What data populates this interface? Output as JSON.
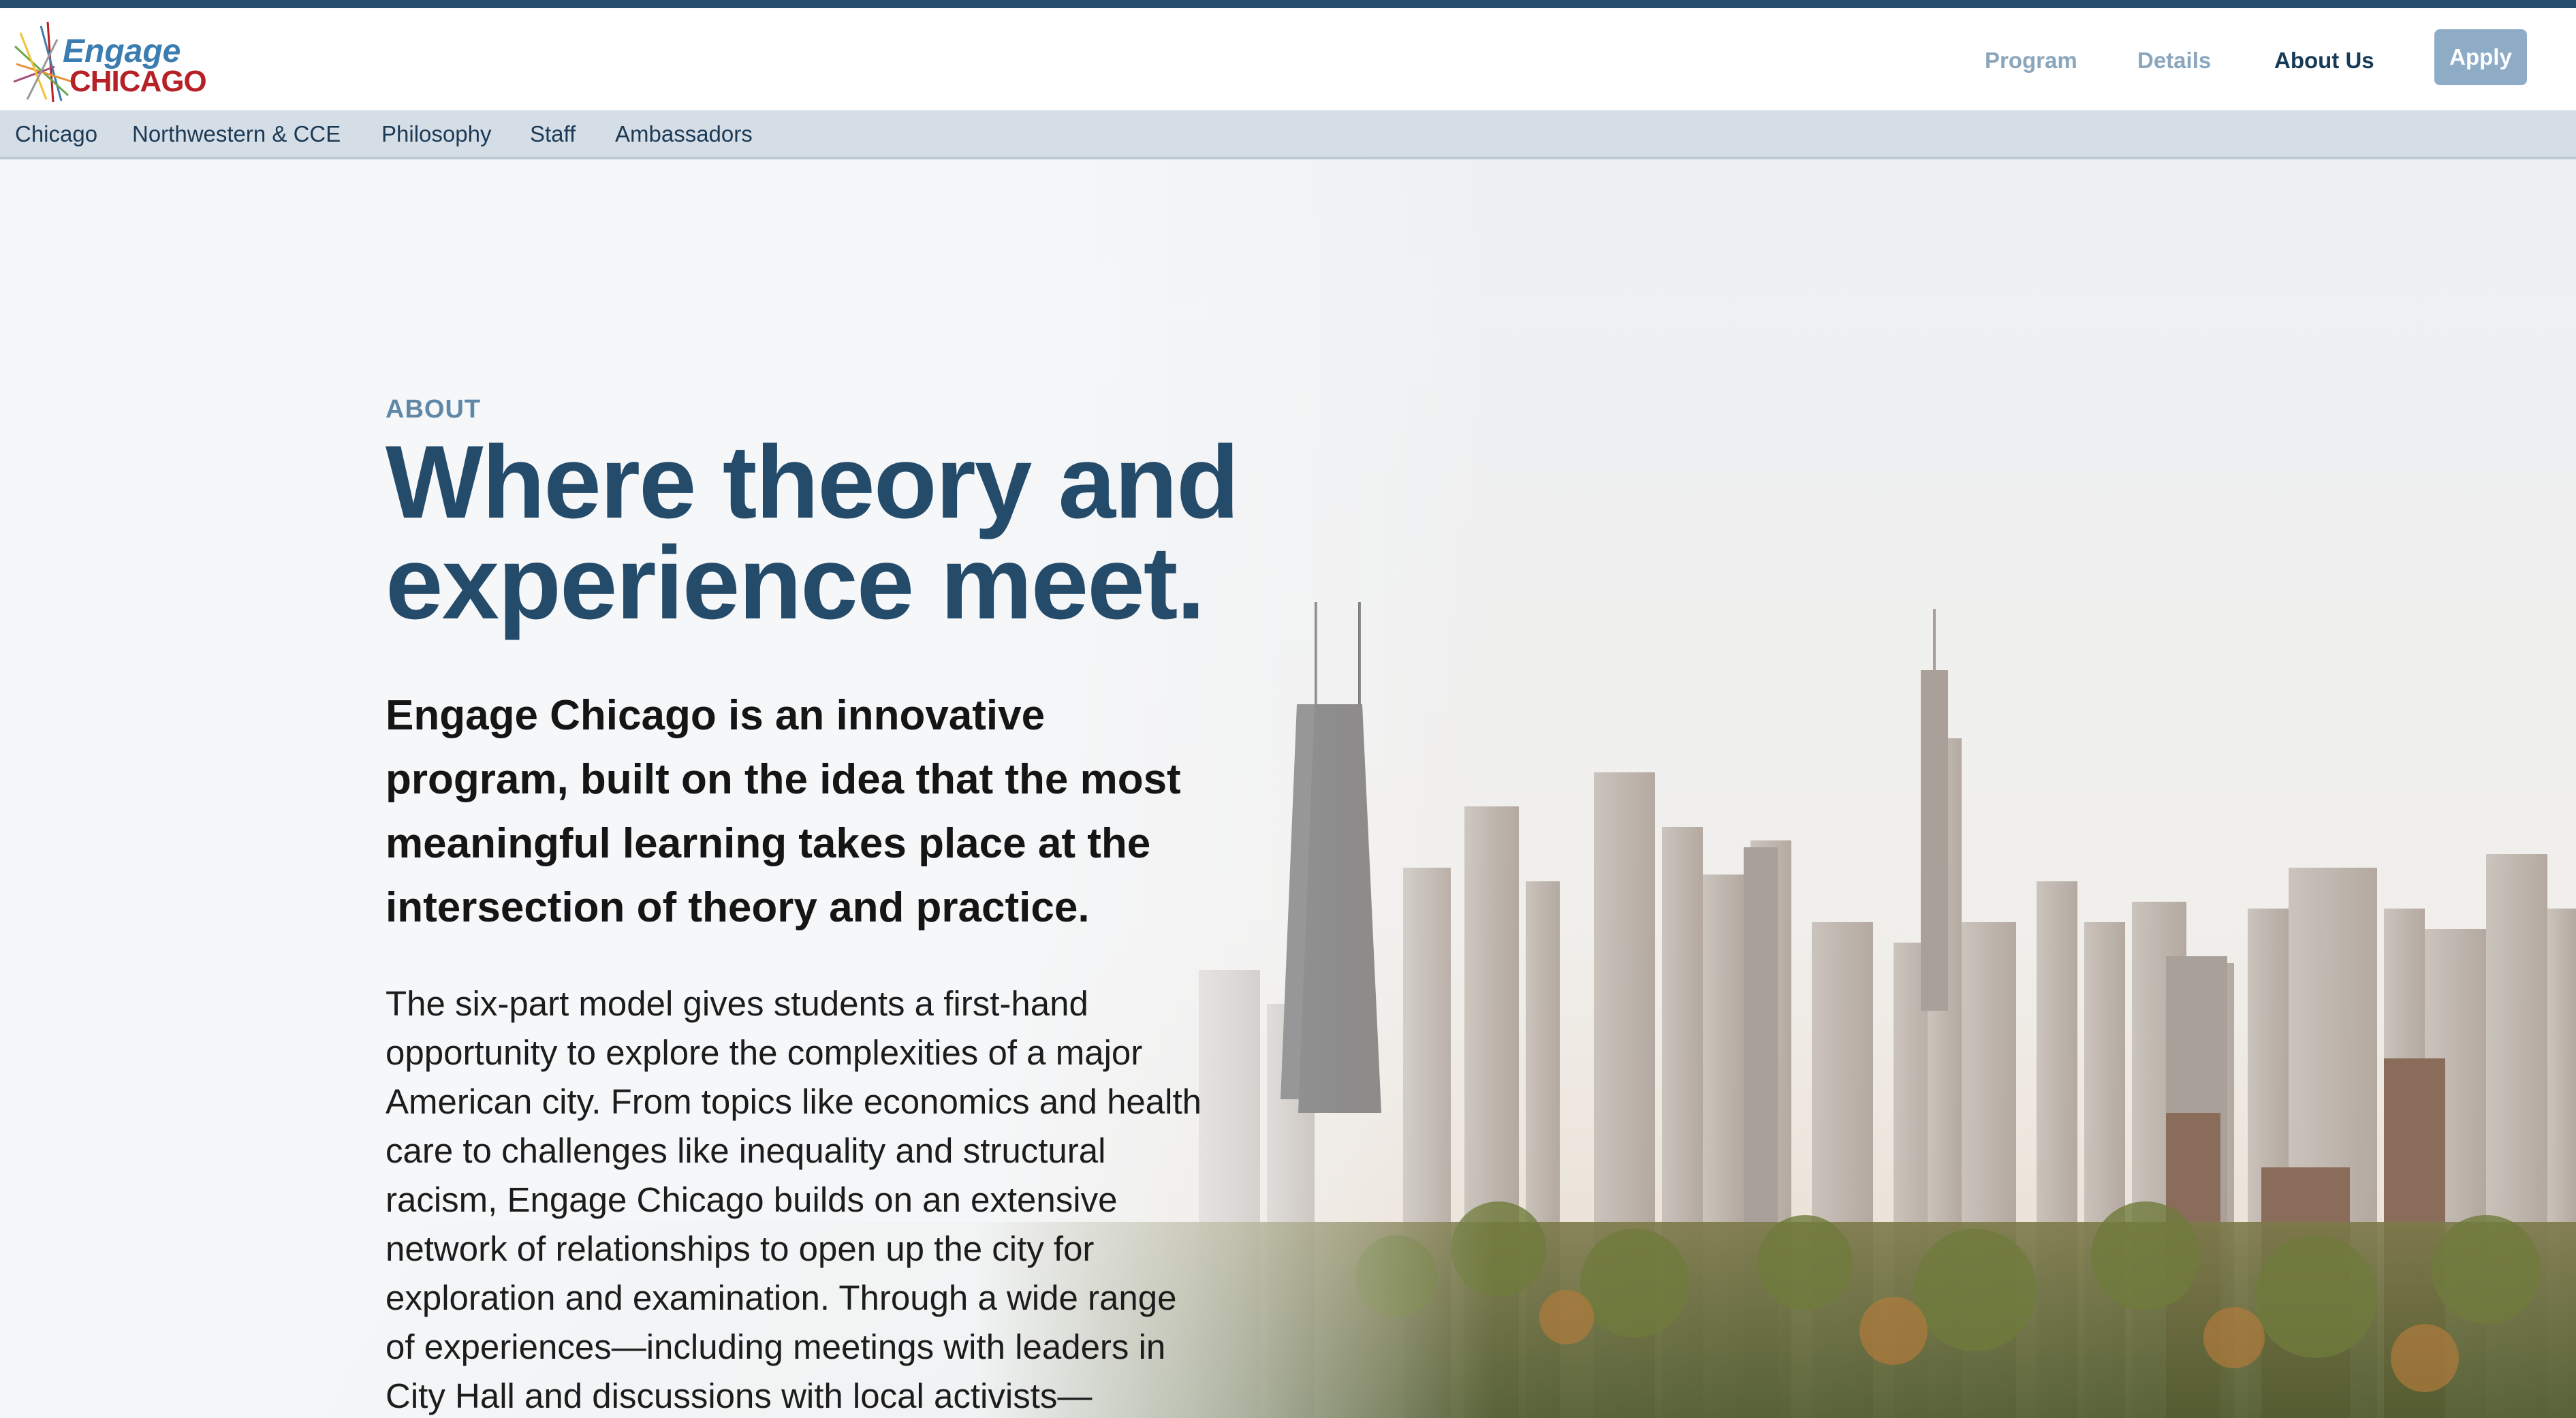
{
  "logo": {
    "line1": "Engage",
    "line2": "CHICAGO"
  },
  "nav": {
    "program": "Program",
    "details": "Details",
    "about": "About Us",
    "apply": "Apply"
  },
  "subnav": [
    "Chicago",
    "Northwestern & CCE",
    "Philosophy",
    "Staff",
    "Ambassadors"
  ],
  "hero": {
    "eyebrow": "ABOUT",
    "headline_line1": "Where theory and",
    "headline_line2": "experience meet.",
    "lead": "Engage Chicago is an innovative program, built on the idea that the most meaningful learning takes place at the intersection of theory and practice.",
    "body": "The six-part model gives students a first-hand opportunity to explore the complexities of a major American city. From topics like economics and health care to challenges like inequality and structural racism, Engage Chicago builds on an extensive network of relationships to open up the city for exploration and examination. Through a wide range of experiences—including meetings with leaders in City Hall and discussions with local activists—students"
  },
  "colors": {
    "topbar": "#264d6b",
    "headline": "#254b6b",
    "eyebrow": "#5f88a8",
    "nav_muted": "#8aa6bd",
    "nav_active": "#173a57",
    "apply_bg": "#8eacc6",
    "subnav_bg": "#d5dee7",
    "logo_blue": "#3b7db0",
    "logo_red": "#b62128"
  },
  "icons": {
    "logo_mark": "transit-lines-logo-icon",
    "background": "chicago-skyline-photo"
  }
}
